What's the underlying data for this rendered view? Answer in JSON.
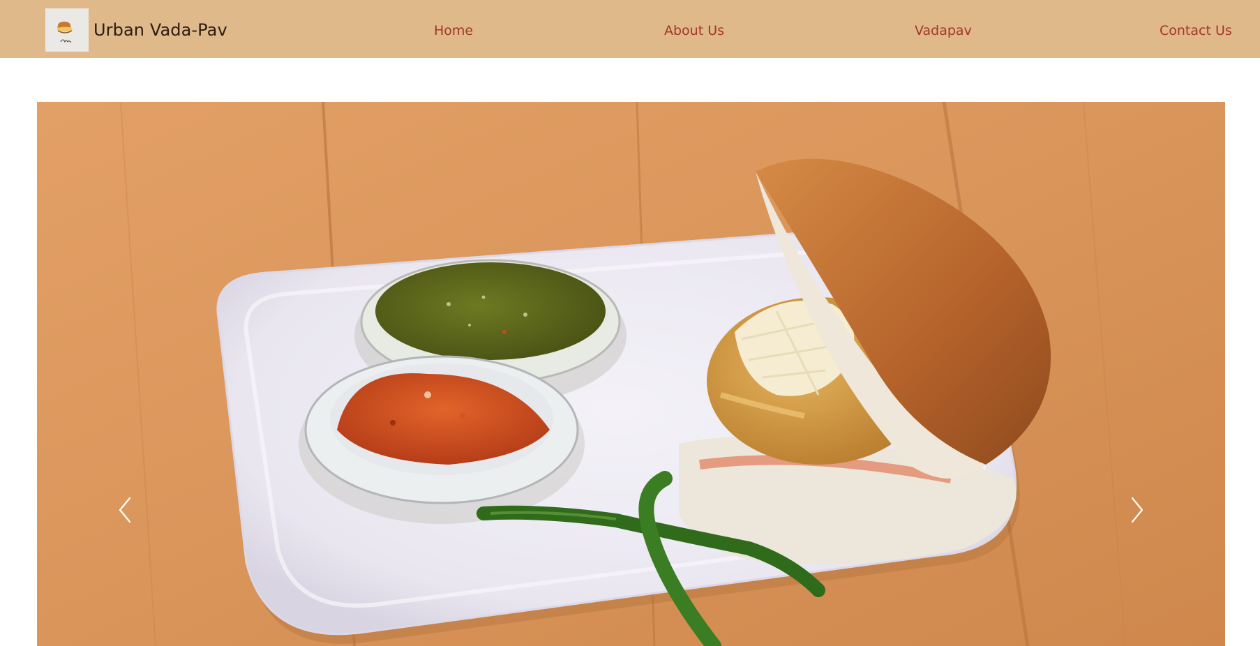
{
  "header": {
    "brand_name": "Urban Vada-Pav",
    "logo_icon": "vada-pav-logo",
    "logo_caption": "Vada pav"
  },
  "nav": {
    "items": [
      {
        "label": "Home"
      },
      {
        "label": "About Us"
      },
      {
        "label": "Vadapav"
      },
      {
        "label": "Contact Us"
      }
    ]
  },
  "hero": {
    "image": "vada-pav-plate-photo",
    "prev_icon": "chevron-left-icon",
    "next_icon": "chevron-right-icon"
  },
  "colors": {
    "navbar_bg": "#e0b98a",
    "nav_link": "#a3352b",
    "brand_text": "#2b1d14"
  }
}
